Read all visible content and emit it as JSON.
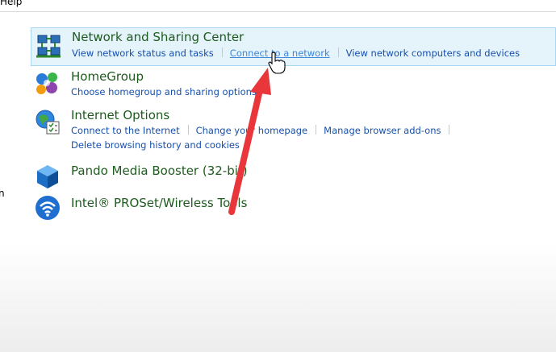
{
  "menu": {
    "help": "Help"
  },
  "left_edge_text": "n",
  "items": [
    {
      "title": "Network and Sharing Center",
      "links": [
        "View network status and tasks",
        "Connect to a network",
        "View network computers and devices"
      ]
    },
    {
      "title": "HomeGroup",
      "links": [
        "Choose homegroup and sharing options"
      ]
    },
    {
      "title": "Internet Options",
      "links": [
        "Connect to the Internet",
        "Change your homepage",
        "Manage browser add-ons",
        "Delete browsing history and cookies"
      ]
    },
    {
      "title": "Pando Media Booster (32-bit)"
    },
    {
      "title": "Intel® PROSet/Wireless Tools"
    }
  ],
  "colors": {
    "title_green": "#1e5b1e",
    "link_blue": "#1650ad",
    "selection_bg": "#e5f3fb",
    "selection_border": "#a7d5f2",
    "annotation_arrow": "#e8363a"
  }
}
